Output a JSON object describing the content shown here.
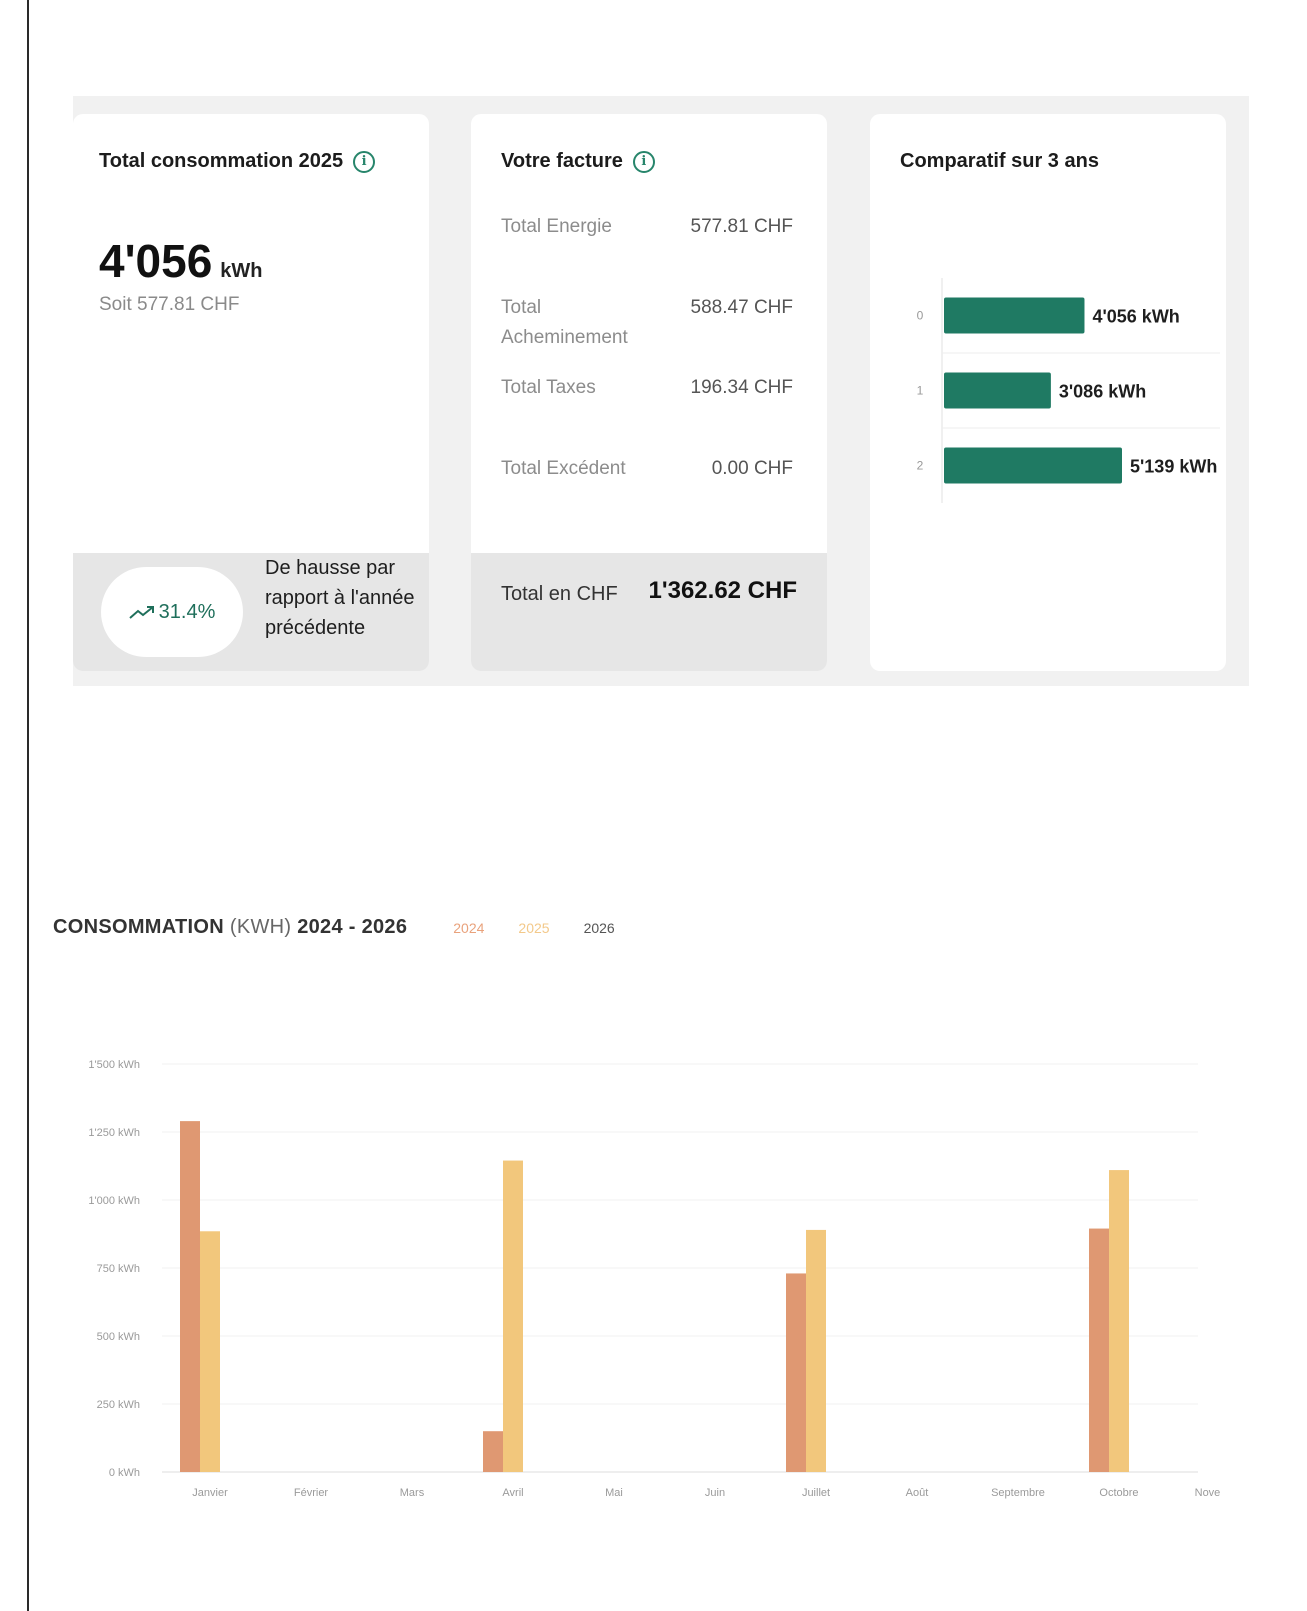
{
  "consumption_card": {
    "title": "Total consommation 2025",
    "value": "4'056",
    "unit": "kWh",
    "subtitle": "Soit 577.81 CHF",
    "trend_value": "31.4%",
    "trend_text": "De hausse par rapport à l'année précédente"
  },
  "bill_card": {
    "title": "Votre facture",
    "rows": [
      {
        "label": "Total Energie",
        "value": "577.81 CHF"
      },
      {
        "label": "Total Acheminement",
        "value": "588.47 CHF"
      },
      {
        "label": "Total Taxes",
        "value": "196.34 CHF"
      },
      {
        "label": "Total Excédent",
        "value": "0.00 CHF"
      }
    ],
    "total_label": "Total en CHF",
    "total_value": "1'362.62 CHF"
  },
  "comparison_card": {
    "title": "Comparatif sur 3 ans",
    "chart_data": {
      "type": "bar",
      "orientation": "horizontal",
      "categories": [
        "0",
        "1",
        "2"
      ],
      "values": [
        4056,
        3086,
        5139
      ],
      "data_labels": [
        "4'056 kWh",
        "3'086 kWh",
        "5'139 kWh"
      ],
      "xlim": [
        0,
        5139
      ],
      "grid": true,
      "color": "#1f7a63"
    }
  },
  "consumption_chart": {
    "title": "CONSOMMATION",
    "title_unit": "(KWH)",
    "title_range": "2024 - 2026",
    "legend": [
      {
        "label": "2024",
        "color": "#e9a27c"
      },
      {
        "label": "2025",
        "color": "#f3c98a"
      },
      {
        "label": "2026",
        "color": "#555555"
      }
    ],
    "chart_data": {
      "type": "bar",
      "categories": [
        "Janvier",
        "Février",
        "Mars",
        "Avril",
        "Mai",
        "Juin",
        "Juillet",
        "Août",
        "Septembre",
        "Octobre",
        "Novembre"
      ],
      "series": [
        {
          "name": "2024",
          "color": "#df9872",
          "values": [
            1290,
            0,
            0,
            150,
            0,
            0,
            730,
            0,
            0,
            895,
            0
          ]
        },
        {
          "name": "2025",
          "color": "#f2c77c",
          "values": [
            885,
            0,
            0,
            1145,
            0,
            0,
            890,
            0,
            0,
            1110,
            0
          ]
        },
        {
          "name": "2026",
          "color": "#555555",
          "values": [
            0,
            0,
            0,
            0,
            0,
            0,
            0,
            0,
            0,
            0,
            0
          ]
        }
      ],
      "ylim": [
        0,
        1500
      ],
      "yticks": [
        0,
        250,
        500,
        750,
        1000,
        1250,
        1500
      ],
      "ytick_labels": [
        "0 kWh",
        "250 kWh",
        "500 kWh",
        "750 kWh",
        "1'000 kWh",
        "1'250 kWh",
        "1'500 kWh"
      ],
      "grid": true
    }
  }
}
